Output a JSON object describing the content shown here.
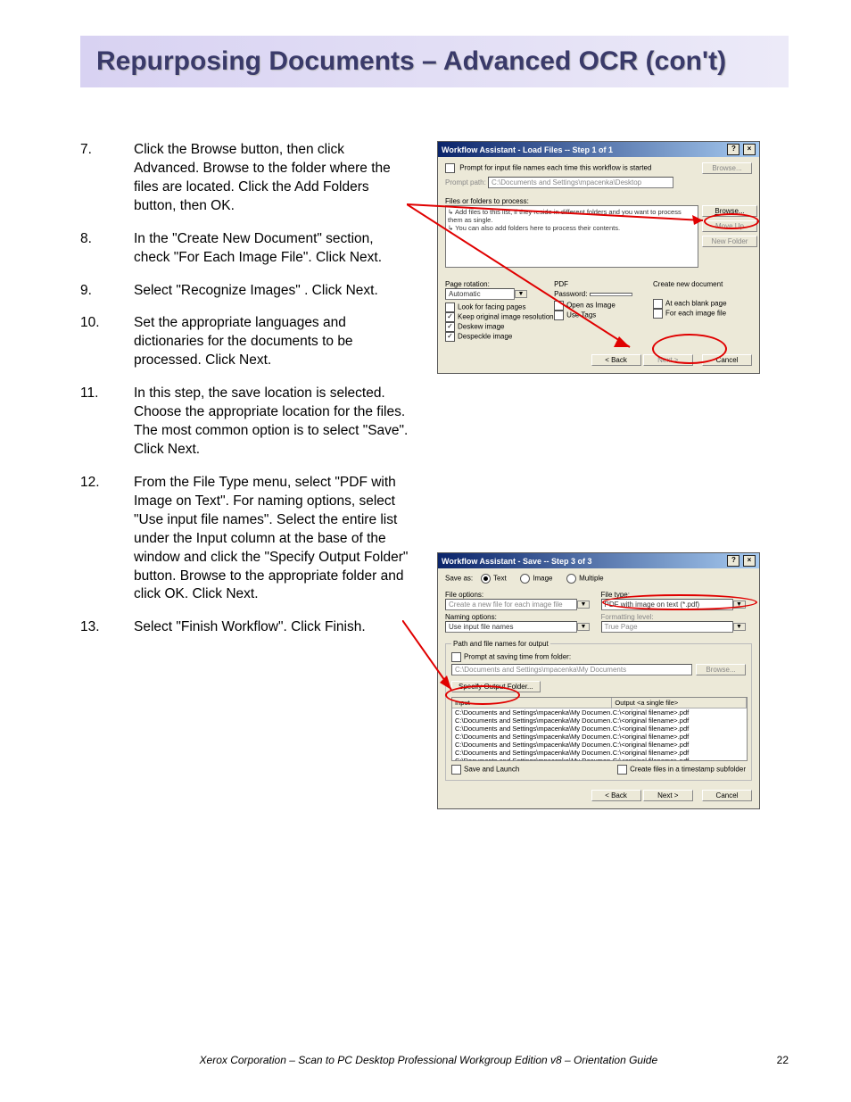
{
  "page_title": "Repurposing Documents – Advanced OCR (con't)",
  "steps": [
    "Click the Browse button, then click Advanced.  Browse to the folder where the files are located.  Click the Add Folders button, then OK.",
    "In the \"Create New Document\" section, check \"For Each Image File\".  Click Next.",
    "Select \"Recognize Images\" . Click Next.",
    "Set the appropriate languages and dictionaries for the documents to be processed. Click Next.",
    "In this step, the save location is selected.  Choose the appropriate location for the files.  The most common option is to select \"Save\".  Click Next.",
    "From the File Type menu, select \"PDF with Image on Text\".  For naming options, select \"Use input file names\".  Select the entire list under the Input column at the base of the window and click the \"Specify Output Folder\" button.  Browse to the appropriate folder and click OK.  Click Next.",
    "Select \"Finish Workflow\".  Click Finish."
  ],
  "dlg1": {
    "title": "Workflow Assistant - Load Files -- Step 1 of 1",
    "prompt_each_start": "Prompt for input file names each time this workflow is started",
    "prompt_path_label": "Prompt path:",
    "prompt_path_value": "C:\\Documents and Settings\\mpacenka\\Desktop",
    "files_to_process": "Files or folders to process:",
    "hint1": "Add files to this list, if they reside in different folders and you want to process them as single.",
    "hint2": "You can also add folders here to process their contents.",
    "btn_browse": "Browse...",
    "btn_moveup": "Move Up",
    "btn_newfolder": "New Folder",
    "page_rotation": "Page rotation:",
    "page_rotation_val": "Automatic",
    "pdf_label": "PDF",
    "pdf_password": "Password:",
    "open_as_image": "Open as Image",
    "use_tags": "Use Tags",
    "create_new_doc": "Create new document",
    "at_each_blank": "At each blank page",
    "for_each_image": "For each image file",
    "look_facing": "Look for facing pages",
    "keep_res": "Keep original image resolution",
    "deskew": "Deskew image",
    "despeckle": "Despeckle image",
    "back": "< Back",
    "next": "Next >",
    "cancel": "Cancel"
  },
  "dlg2": {
    "title": "Workflow Assistant - Save -- Step 3 of 3",
    "save_as": "Save as:",
    "opt_text": "Text",
    "opt_image": "Image",
    "opt_multiple": "Multiple",
    "file_options": "File options:",
    "file_options_val": "Create a new file for each image file",
    "file_type": "File type:",
    "file_type_val": "PDF with image on text (*.pdf)",
    "naming_options": "Naming options:",
    "naming_val": "Use input file names",
    "formatting_level": "Formatting level:",
    "formatting_val": "True Page",
    "path_label": "Path and file names for output",
    "prompt_save_time": "Prompt at saving time from folder:",
    "path_val": "C:\\Documents and Settings\\mpacenka\\My Documents",
    "specify_output": "Specify Output Folder...",
    "browse": "Browse...",
    "col_input": "Input",
    "col_output": "Output <a single file>",
    "row_in": "C:\\Documents and Settings\\mpacenka\\My Documen...",
    "row_out": "C:\\<original filename>.pdf",
    "save_launch": "Save and Launch",
    "timestamp": "Create files in a timestamp subfolder",
    "back": "< Back",
    "next": "Next >",
    "cancel": "Cancel"
  },
  "footer_text": "Xerox Corporation – Scan to PC Desktop Professional Workgroup Edition v8 – Orientation Guide",
  "page_number": "22"
}
